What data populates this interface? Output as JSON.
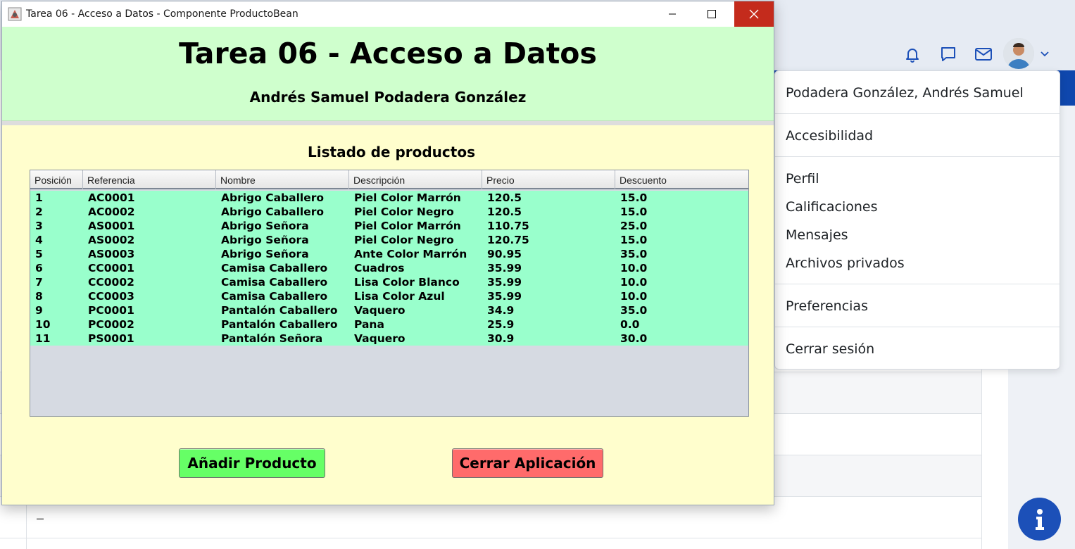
{
  "window": {
    "title": "Tarea 06 - Acceso a Datos - Componente ProductoBean",
    "heading": "Tarea 06 - Acceso a Datos",
    "author": "Andrés Samuel Podadera González",
    "list_title": "Listado de productos"
  },
  "table": {
    "columns": [
      "Posición",
      "Referencia",
      "Nombre",
      "Descripción",
      "Precio",
      "Descuento"
    ],
    "rows": [
      [
        "1",
        "AC0001",
        "Abrigo Caballero",
        "Piel Color Marrón",
        "120.5",
        "15.0"
      ],
      [
        "2",
        "AC0002",
        "Abrigo Caballero",
        "Piel Color Negro",
        "120.5",
        "15.0"
      ],
      [
        "3",
        "AS0001",
        "Abrigo Señora",
        "Piel Color Marrón",
        "110.75",
        "25.0"
      ],
      [
        "4",
        "AS0002",
        "Abrigo Señora",
        "Piel Color Negro",
        "120.75",
        "15.0"
      ],
      [
        "5",
        "AS0003",
        "Abrigo Señora",
        "Ante  Color Marrón",
        "90.95",
        "35.0"
      ],
      [
        "6",
        "CC0001",
        "Camisa Caballero",
        "Cuadros",
        "35.99",
        "10.0"
      ],
      [
        "7",
        "CC0002",
        "Camisa Caballero",
        "Lisa Color Blanco",
        "35.99",
        "10.0"
      ],
      [
        "8",
        "CC0003",
        "Camisa Caballero",
        "Lisa Color Azul",
        "35.99",
        "10.0"
      ],
      [
        "9",
        "PC0001",
        "Pantalón Caballero",
        "Vaquero",
        "34.9",
        "35.0"
      ],
      [
        "10",
        "PC0002",
        "Pantalón Caballero",
        "Pana",
        "25.9",
        "0.0"
      ],
      [
        "11",
        "PS0001",
        "Pantalón Señora",
        "Vaquero",
        "30.9",
        "30.0"
      ]
    ]
  },
  "buttons": {
    "add": "Añadir Producto",
    "close": "Cerrar Aplicación"
  },
  "user_menu": {
    "user_name": "Podadera González, Andrés Samuel",
    "accessibility": "Accesibilidad",
    "profile": "Perfil",
    "grades": "Calificaciones",
    "messages": "Mensajes",
    "private_files": "Archivos privados",
    "preferences": "Preferencias",
    "logout": "Cerrar sesión"
  },
  "background": {
    "dash": "–"
  },
  "colors": {
    "header_bg": "#cfffcd",
    "window_bg": "#fffecd",
    "table_rows_bg": "#99ffcc",
    "add_button": "#66ff66",
    "close_button": "#ff6b6b",
    "brand_blue": "#0f47ad",
    "close_window": "#c42b1c"
  },
  "icons": [
    "java-app-icon",
    "minimize-icon",
    "maximize-icon",
    "close-icon",
    "bell-icon",
    "chat-icon",
    "mail-icon",
    "chevron-down-icon",
    "info-icon"
  ]
}
